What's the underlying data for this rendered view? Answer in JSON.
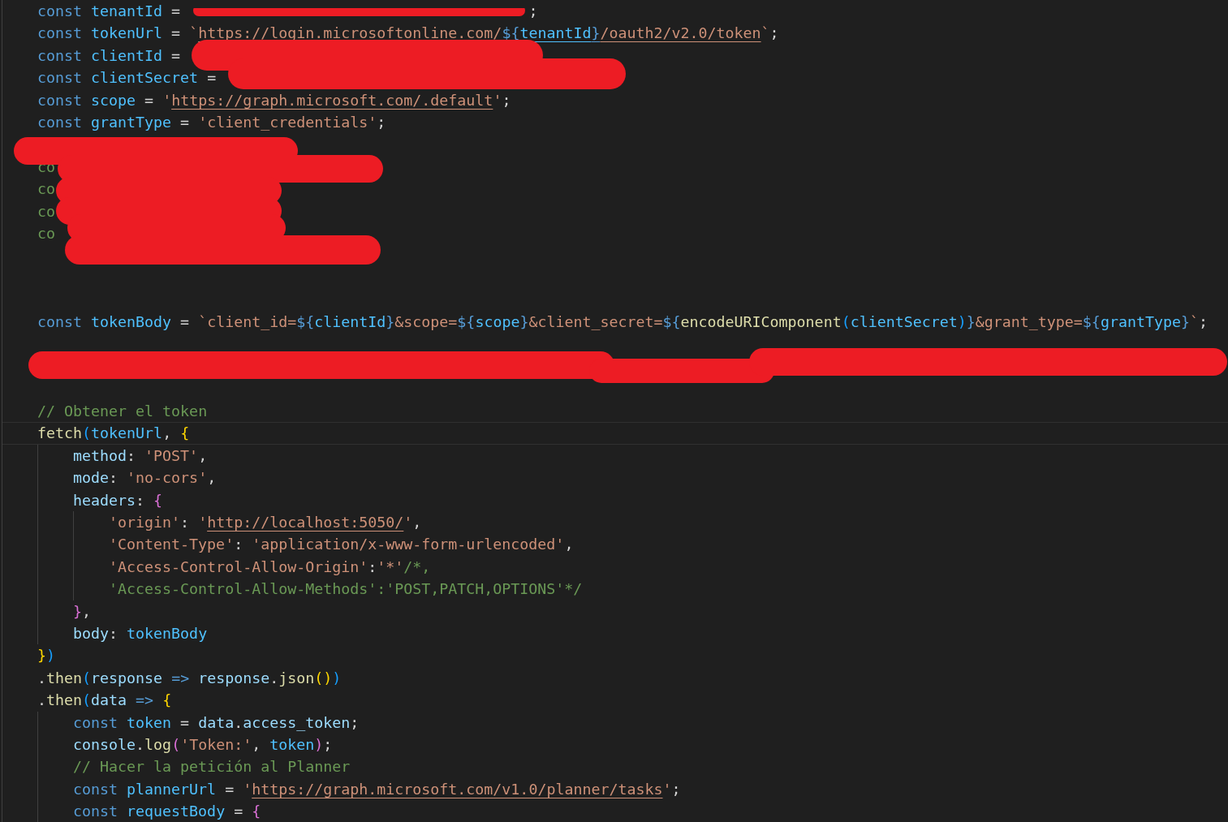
{
  "editor": {
    "lines": [
      {
        "current": false,
        "tokens": [
          {
            "kind": "kw",
            "text": "const"
          },
          {
            "kind": "var",
            "text": " tenantId"
          },
          {
            "kind": "op",
            "text": " = "
          },
          {
            "kind": "redacted"
          },
          {
            "kind": "op",
            "text": ";"
          }
        ]
      },
      {
        "current": false,
        "tokens": [
          {
            "kind": "kw",
            "text": "const"
          },
          {
            "kind": "var",
            "text": " tokenUrl"
          },
          {
            "kind": "op",
            "text": " = "
          },
          {
            "kind": "str",
            "text": "`"
          },
          {
            "kind": "url",
            "text": "https://login.microsoftonline.com/"
          },
          {
            "kind": "url-interp",
            "text": "${"
          },
          {
            "kind": "url-var",
            "text": "tenantId"
          },
          {
            "kind": "url-interp",
            "text": "}"
          },
          {
            "kind": "url",
            "text": "/oauth2/v2.0/token"
          },
          {
            "kind": "str",
            "text": "`"
          },
          {
            "kind": "op",
            "text": ";"
          }
        ]
      },
      {
        "current": false,
        "tokens": [
          {
            "kind": "kw",
            "text": "const"
          },
          {
            "kind": "var",
            "text": " clientId"
          },
          {
            "kind": "op",
            "text": " ="
          }
        ]
      },
      {
        "current": false,
        "tokens": [
          {
            "kind": "kw",
            "text": "const"
          },
          {
            "kind": "var",
            "text": " clientSecret"
          },
          {
            "kind": "op",
            "text": " ="
          }
        ]
      },
      {
        "current": false,
        "tokens": [
          {
            "kind": "kw",
            "text": "const"
          },
          {
            "kind": "var",
            "text": " scope"
          },
          {
            "kind": "op",
            "text": " = "
          },
          {
            "kind": "str",
            "text": "'"
          },
          {
            "kind": "url",
            "text": "https://graph.microsoft.com/.default"
          },
          {
            "kind": "str",
            "text": "'"
          },
          {
            "kind": "op",
            "text": ";"
          }
        ]
      },
      {
        "current": false,
        "tokens": [
          {
            "kind": "kw",
            "text": "const"
          },
          {
            "kind": "var",
            "text": " grantType"
          },
          {
            "kind": "op",
            "text": " = "
          },
          {
            "kind": "str",
            "text": "'client_credentials'"
          },
          {
            "kind": "op",
            "text": ";"
          }
        ]
      },
      {
        "current": false
      },
      {
        "current": false,
        "tokens": [
          {
            "kind": "comment",
            "text": "co"
          }
        ]
      },
      {
        "current": false,
        "tokens": [
          {
            "kind": "comment",
            "text": "co"
          }
        ]
      },
      {
        "current": false,
        "tokens": [
          {
            "kind": "comment",
            "text": "co"
          }
        ]
      },
      {
        "current": false,
        "tokens": [
          {
            "kind": "comment",
            "text": "co"
          }
        ]
      },
      {
        "current": false
      },
      {
        "current": false
      },
      {
        "current": false
      },
      {
        "current": false,
        "tokens": [
          {
            "kind": "kw",
            "text": "const"
          },
          {
            "kind": "var",
            "text": " tokenBody"
          },
          {
            "kind": "op",
            "text": " = "
          },
          {
            "kind": "str",
            "text": "`client_id="
          },
          {
            "kind": "interp",
            "text": "${"
          },
          {
            "kind": "var",
            "text": "clientId"
          },
          {
            "kind": "interp",
            "text": "}"
          },
          {
            "kind": "str",
            "text": "&scope="
          },
          {
            "kind": "interp",
            "text": "${"
          },
          {
            "kind": "var",
            "text": "scope"
          },
          {
            "kind": "interp",
            "text": "}"
          },
          {
            "kind": "str",
            "text": "&client_secret="
          },
          {
            "kind": "interp",
            "text": "${"
          },
          {
            "kind": "fn",
            "text": "encodeURIComponent"
          },
          {
            "kind": "b3",
            "text": "("
          },
          {
            "kind": "var",
            "text": "clientSecret"
          },
          {
            "kind": "b3",
            "text": ")"
          },
          {
            "kind": "interp",
            "text": "}"
          },
          {
            "kind": "str",
            "text": "&grant_type="
          },
          {
            "kind": "interp",
            "text": "${"
          },
          {
            "kind": "var",
            "text": "grantType"
          },
          {
            "kind": "interp",
            "text": "}"
          },
          {
            "kind": "str",
            "text": "`"
          },
          {
            "kind": "op",
            "text": ";"
          }
        ]
      },
      {
        "current": false
      },
      {
        "current": false
      },
      {
        "current": false
      },
      {
        "current": false,
        "tokens": [
          {
            "kind": "comment",
            "text": "// Obtener el token"
          }
        ]
      },
      {
        "current": true,
        "tokens": [
          {
            "kind": "fn",
            "text": "fetch"
          },
          {
            "kind": "b3",
            "text": "("
          },
          {
            "kind": "var",
            "text": "tokenUrl"
          },
          {
            "kind": "op",
            "text": ", "
          },
          {
            "kind": "b1",
            "text": "{"
          }
        ],
        "children": [
          {
            "current": false,
            "tokens": [
              {
                "kind": "prop",
                "text": "method"
              },
              {
                "kind": "op",
                "text": ": "
              },
              {
                "kind": "str",
                "text": "'POST'"
              },
              {
                "kind": "op",
                "text": ","
              }
            ]
          },
          {
            "current": false,
            "tokens": [
              {
                "kind": "prop",
                "text": "mode"
              },
              {
                "kind": "op",
                "text": ": "
              },
              {
                "kind": "str",
                "text": "'no-cors'"
              },
              {
                "kind": "op",
                "text": ","
              }
            ]
          },
          {
            "current": false,
            "tokens": [
              {
                "kind": "prop",
                "text": "headers"
              },
              {
                "kind": "op",
                "text": ": "
              },
              {
                "kind": "b2",
                "text": "{"
              }
            ],
            "children": [
              {
                "current": false,
                "tokens": [
                  {
                    "kind": "str",
                    "text": "'origin'"
                  },
                  {
                    "kind": "op",
                    "text": ": "
                  },
                  {
                    "kind": "str",
                    "text": "'"
                  },
                  {
                    "kind": "url",
                    "text": "http://localhost:5050/"
                  },
                  {
                    "kind": "str",
                    "text": "'"
                  },
                  {
                    "kind": "op",
                    "text": ","
                  }
                ]
              },
              {
                "current": false,
                "tokens": [
                  {
                    "kind": "str",
                    "text": "'Content-Type'"
                  },
                  {
                    "kind": "op",
                    "text": ": "
                  },
                  {
                    "kind": "str",
                    "text": "'application/x-www-form-urlencoded'"
                  },
                  {
                    "kind": "op",
                    "text": ","
                  }
                ]
              },
              {
                "current": false,
                "tokens": [
                  {
                    "kind": "str",
                    "text": "'Access-Control-Allow-Origin'"
                  },
                  {
                    "kind": "op",
                    "text": ":"
                  },
                  {
                    "kind": "str",
                    "text": "'*'"
                  },
                  {
                    "kind": "comment",
                    "text": "/*,"
                  }
                ]
              },
              {
                "current": false,
                "tokens": [
                  {
                    "kind": "comment",
                    "text": "'Access-Control-Allow-Methods':'POST,PATCH,OPTIONS'*/"
                  }
                ]
              }
            ]
          },
          {
            "current": false,
            "tokens": [
              {
                "kind": "b2",
                "text": "}"
              },
              {
                "kind": "op",
                "text": ","
              }
            ]
          },
          {
            "current": false,
            "tokens": [
              {
                "kind": "prop",
                "text": "body"
              },
              {
                "kind": "op",
                "text": ": "
              },
              {
                "kind": "var",
                "text": "tokenBody"
              }
            ]
          }
        ]
      },
      {
        "current": false,
        "tokens": [
          {
            "kind": "b1",
            "text": "}"
          },
          {
            "kind": "b3",
            "text": ")"
          }
        ]
      },
      {
        "current": false,
        "tokens": [
          {
            "kind": "op",
            "text": "."
          },
          {
            "kind": "fn",
            "text": "then"
          },
          {
            "kind": "b3",
            "text": "("
          },
          {
            "kind": "prop",
            "text": "response"
          },
          {
            "kind": "kw",
            "text": " => "
          },
          {
            "kind": "prop",
            "text": "response"
          },
          {
            "kind": "op",
            "text": "."
          },
          {
            "kind": "fn",
            "text": "json"
          },
          {
            "kind": "b1",
            "text": "()"
          },
          {
            "kind": "b3",
            "text": ")"
          }
        ]
      },
      {
        "current": false,
        "tokens": [
          {
            "kind": "op",
            "text": "."
          },
          {
            "kind": "fn",
            "text": "then"
          },
          {
            "kind": "b3",
            "text": "("
          },
          {
            "kind": "prop",
            "text": "data"
          },
          {
            "kind": "kw",
            "text": " => "
          },
          {
            "kind": "b1",
            "text": "{"
          }
        ],
        "children": [
          {
            "current": false,
            "tokens": [
              {
                "kind": "kw",
                "text": "const"
              },
              {
                "kind": "var",
                "text": " token"
              },
              {
                "kind": "op",
                "text": " = "
              },
              {
                "kind": "prop",
                "text": "data"
              },
              {
                "kind": "op",
                "text": "."
              },
              {
                "kind": "prop",
                "text": "access_token"
              },
              {
                "kind": "op",
                "text": ";"
              }
            ]
          },
          {
            "current": false,
            "tokens": [
              {
                "kind": "prop",
                "text": "console"
              },
              {
                "kind": "op",
                "text": "."
              },
              {
                "kind": "fn",
                "text": "log"
              },
              {
                "kind": "b2",
                "text": "("
              },
              {
                "kind": "str",
                "text": "'Token:'"
              },
              {
                "kind": "op",
                "text": ", "
              },
              {
                "kind": "var",
                "text": "token"
              },
              {
                "kind": "b2",
                "text": ")"
              },
              {
                "kind": "op",
                "text": ";"
              }
            ]
          },
          {
            "current": false,
            "tokens": [
              {
                "kind": "comment",
                "text": "// Hacer la petición al Planner"
              }
            ]
          },
          {
            "current": false,
            "tokens": [
              {
                "kind": "kw",
                "text": "const"
              },
              {
                "kind": "var",
                "text": " plannerUrl"
              },
              {
                "kind": "op",
                "text": " = "
              },
              {
                "kind": "str",
                "text": "'"
              },
              {
                "kind": "url",
                "text": "https://graph.microsoft.com/v1.0/planner/tasks"
              },
              {
                "kind": "str",
                "text": "'"
              },
              {
                "kind": "op",
                "text": ";"
              }
            ]
          },
          {
            "current": false,
            "tokens": [
              {
                "kind": "kw",
                "text": "const"
              },
              {
                "kind": "var",
                "text": " requestBody"
              },
              {
                "kind": "op",
                "text": " = "
              },
              {
                "kind": "b2",
                "text": "{"
              }
            ]
          }
        ]
      }
    ]
  }
}
